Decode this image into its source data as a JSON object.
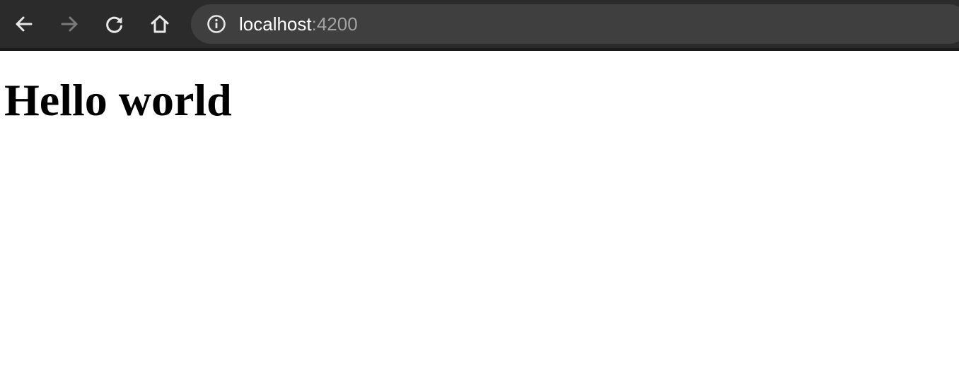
{
  "browser": {
    "address_bar": {
      "host": "localhost",
      "port": ":4200"
    },
    "buttons": {
      "back_icon": "arrow-left-icon",
      "forward_icon": "arrow-right-icon",
      "reload_icon": "reload-icon",
      "home_icon": "home-icon",
      "site_info_icon": "info-icon"
    },
    "colors": {
      "toolbar": "#2b2b2c",
      "omnibox": "#3f3f3f",
      "icon_active": "#e8e8e8",
      "icon_disabled": "#7a7a7a"
    }
  },
  "page": {
    "heading": "Hello world"
  }
}
